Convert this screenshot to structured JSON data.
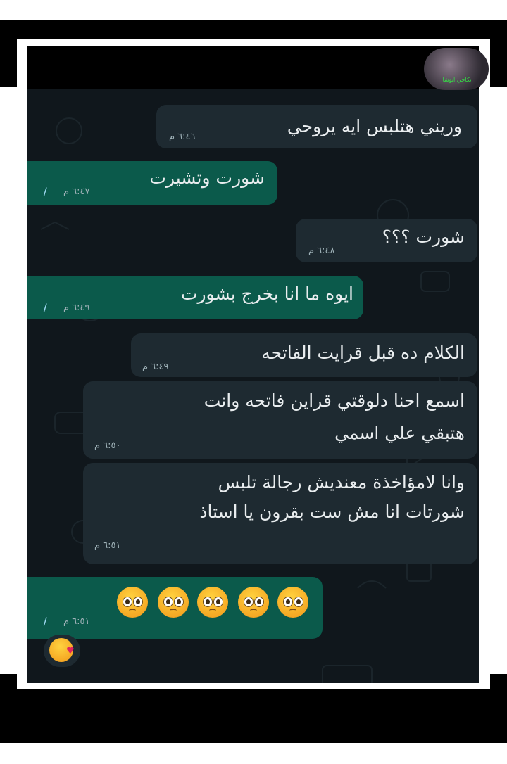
{
  "watermark": {
    "text": "تكاجي انوشا"
  },
  "messages": [
    {
      "id": "m1",
      "dir": "in",
      "text": "وريني هتلبس ايه يروحي",
      "time": "٦:٤٦ م"
    },
    {
      "id": "m2",
      "dir": "out",
      "text": "شورت وتشيرت",
      "time": "٦:٤٧ م",
      "read": "//"
    },
    {
      "id": "m3",
      "dir": "in",
      "text": "شورت ؟؟؟",
      "time": "٦:٤٨ م"
    },
    {
      "id": "m4",
      "dir": "out",
      "text": "ايوه ما انا بخرج بشورت",
      "time": "٦:٤٩ م",
      "read": "//"
    },
    {
      "id": "m5",
      "dir": "in",
      "text": "الكلام ده قبل قرايت الفاتحه",
      "time": "٦:٤٩ م"
    },
    {
      "id": "m6",
      "dir": "in",
      "lines": [
        "اسمع احنا دلوقتي قراين فاتحه وانت",
        "هتبقي علي اسمي"
      ],
      "time": "٦:٥٠ م"
    },
    {
      "id": "m7",
      "dir": "in",
      "lines": [
        "وانا لامؤاخذة معنديش رجالة تلبس",
        "شورتات انا مش ست بقرون يا استاذ"
      ],
      "time": "٦:٥١ م"
    },
    {
      "id": "m8",
      "dir": "out",
      "emoji_count": 5,
      "emoji": "pleading-face",
      "time": "٦:٥١ م",
      "read": "//"
    }
  ],
  "reaction": {
    "emoji": "face-blowing-a-kiss"
  },
  "colors": {
    "incoming": "#1e2a31",
    "outgoing": "#0b5a4b",
    "background": "#10171c",
    "read_ticks": "#9fd9f2"
  }
}
